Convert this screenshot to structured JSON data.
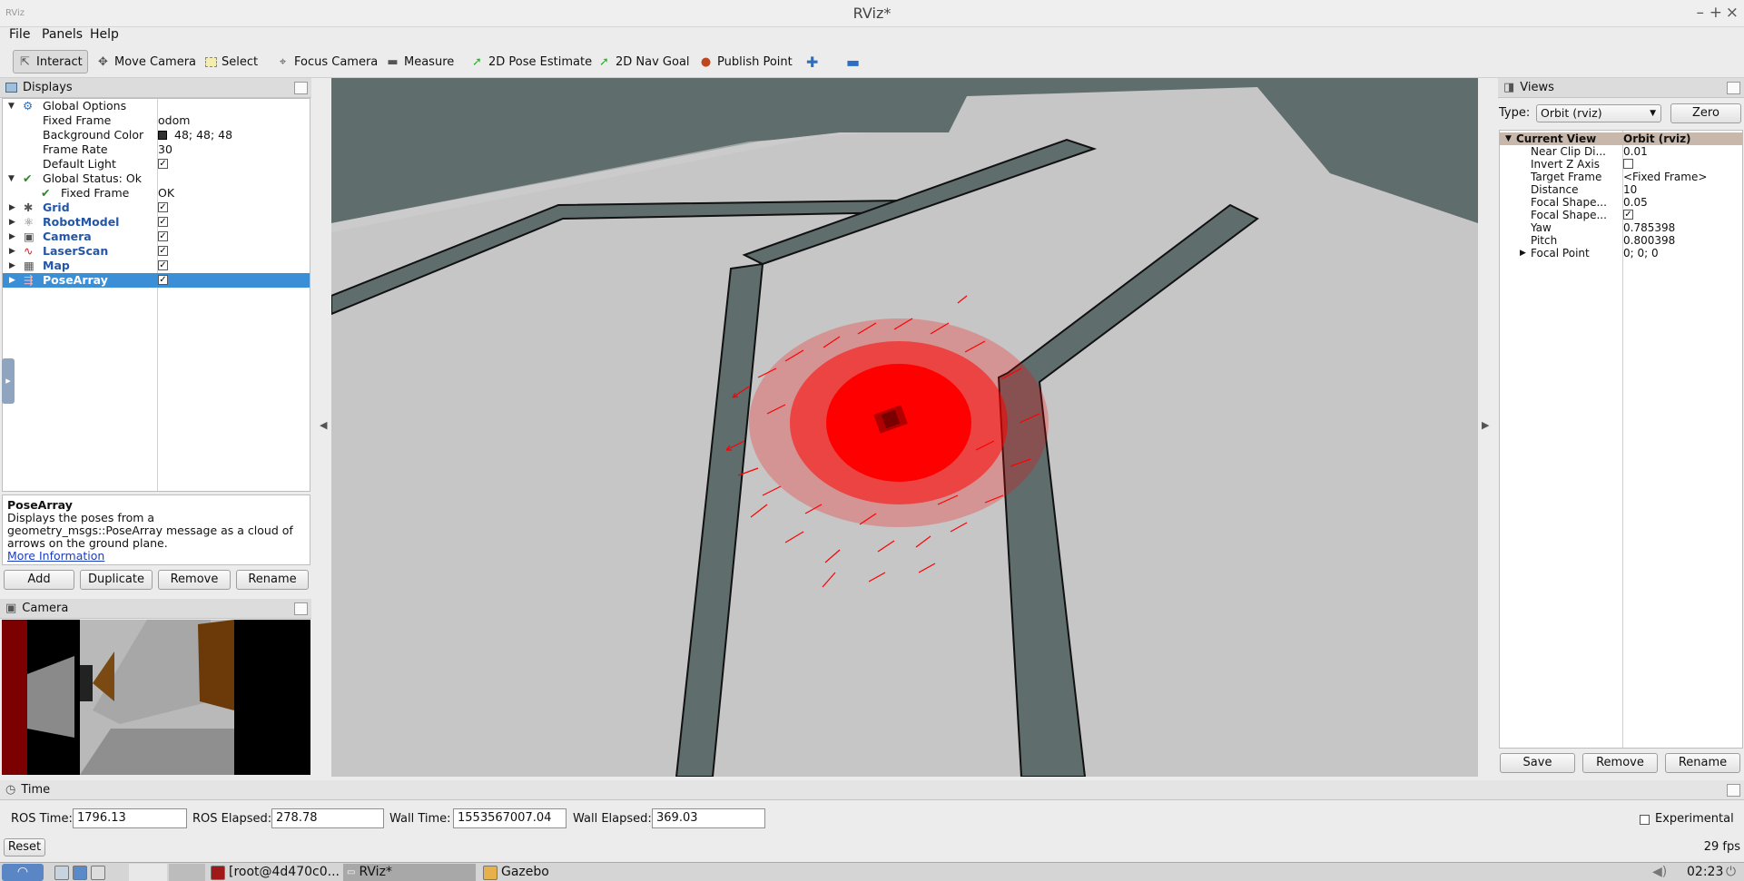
{
  "window": {
    "title": "RViz*",
    "app_icon": "RViz"
  },
  "menus": [
    "File",
    "Panels",
    "Help"
  ],
  "toolbar": {
    "tools": [
      {
        "label": "Interact",
        "icon": "interact-icon",
        "active": true
      },
      {
        "label": "Move Camera",
        "icon": "move-camera-icon"
      },
      {
        "label": "Select",
        "icon": "select-icon"
      },
      {
        "label": "Focus Camera",
        "icon": "focus-camera-icon"
      },
      {
        "label": "Measure",
        "icon": "measure-icon"
      },
      {
        "label": "2D Pose Estimate",
        "icon": "pose-estimate-icon"
      },
      {
        "label": "2D Nav Goal",
        "icon": "nav-goal-icon"
      },
      {
        "label": "Publish Point",
        "icon": "publish-point-icon"
      }
    ]
  },
  "displays": {
    "header": "Displays",
    "global_options": {
      "label": "Global Options",
      "fixed_frame_label": "Fixed Frame",
      "fixed_frame": "odom",
      "bg_label": "Background Color",
      "bg_value": "48; 48; 48",
      "bg_swatch": "#303030",
      "rate_label": "Frame Rate",
      "rate": "30",
      "light_label": "Default Light"
    },
    "global_status": {
      "label": "Global Status: Ok",
      "fixed_frame_label": "Fixed Frame",
      "fixed_frame_status": "OK"
    },
    "items": [
      {
        "label": "Grid",
        "icon": "grid-icon"
      },
      {
        "label": "RobotModel",
        "icon": "robot-model-icon"
      },
      {
        "label": "Camera",
        "icon": "camera-icon"
      },
      {
        "label": "LaserScan",
        "icon": "laser-scan-icon"
      },
      {
        "label": "Map",
        "icon": "map-icon"
      },
      {
        "label": "PoseArray",
        "icon": "pose-array-icon",
        "selected": true
      }
    ],
    "description_title": "PoseArray",
    "description_text": "Displays the poses from a geometry_msgs::PoseArray message as a cloud of arrows on the ground plane.",
    "more_info": "More Information",
    "buttons": [
      "Add",
      "Duplicate",
      "Remove",
      "Rename"
    ]
  },
  "camera_panel": {
    "header": "Camera"
  },
  "views": {
    "header": "Views",
    "type_label": "Type:",
    "type_value": "Orbit (rviz)",
    "zero": "Zero",
    "current_view_label": "Current View",
    "current_view_value": "Orbit (rviz)",
    "props": [
      {
        "label": "Near Clip Di...",
        "value": "0.01"
      },
      {
        "label": "Invert Z Axis",
        "value": ""
      },
      {
        "label": "Target Frame",
        "value": "<Fixed Frame>"
      },
      {
        "label": "Distance",
        "value": "10"
      },
      {
        "label": "Focal Shape...",
        "value": "0.05"
      },
      {
        "label": "Focal Shape...",
        "value": ""
      },
      {
        "label": "Yaw",
        "value": "0.785398"
      },
      {
        "label": "Pitch",
        "value": "0.800398"
      },
      {
        "label": "Focal Point",
        "value": "0; 0; 0"
      }
    ],
    "buttons": [
      "Save",
      "Remove",
      "Rename"
    ]
  },
  "time": {
    "header": "Time",
    "ros_time_label": "ROS Time:",
    "ros_time": "1796.13",
    "ros_elapsed_label": "ROS Elapsed:",
    "ros_elapsed": "278.78",
    "wall_time_label": "Wall Time:",
    "wall_time": "1553567007.04",
    "wall_elapsed_label": "Wall Elapsed:",
    "wall_elapsed": "369.03",
    "experimental": "Experimental",
    "reset": "Reset",
    "fps": "29 fps"
  },
  "taskbar": {
    "tasks": [
      "[root@4d470c0...",
      "RViz*",
      "Gazebo"
    ],
    "clock": "02:23"
  },
  "colors": {
    "accent": "#3b8fd6",
    "ground": "#c8c8c8",
    "wall": "#5f6d6d",
    "arrows": "#ff0000"
  }
}
